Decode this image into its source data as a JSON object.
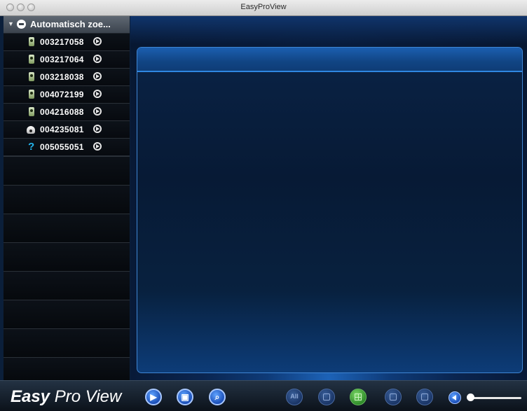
{
  "window": {
    "title": "EasyProView"
  },
  "sidebar": {
    "group_label": "Automatisch zoe...",
    "items": [
      {
        "id": "003217058",
        "icon": "camera-icon"
      },
      {
        "id": "003217064",
        "icon": "camera-icon"
      },
      {
        "id": "003218038",
        "icon": "camera-icon"
      },
      {
        "id": "004072199",
        "icon": "camera-icon"
      },
      {
        "id": "004216088",
        "icon": "camera-icon"
      },
      {
        "id": "004235081",
        "icon": "dome-camera-icon"
      },
      {
        "id": "005055051",
        "icon": "unknown-device-icon",
        "glyph": "?"
      }
    ]
  },
  "bottom_bar": {
    "logo_bold": "Easy",
    "logo_light": "Pro View",
    "all_button_label": "All",
    "buttons": [
      "play-icon",
      "multi-view-icon",
      "search-icon",
      "all-button",
      "single-view-icon",
      "quad-view-icon",
      "layout-view-icon",
      "grid-view-icon",
      "volume-icon"
    ]
  },
  "colors": {
    "accent": "#1b4fb8",
    "background": "#071731",
    "sidebar_bg": "#0a0f17",
    "active_layout": "#2f8a2a"
  }
}
